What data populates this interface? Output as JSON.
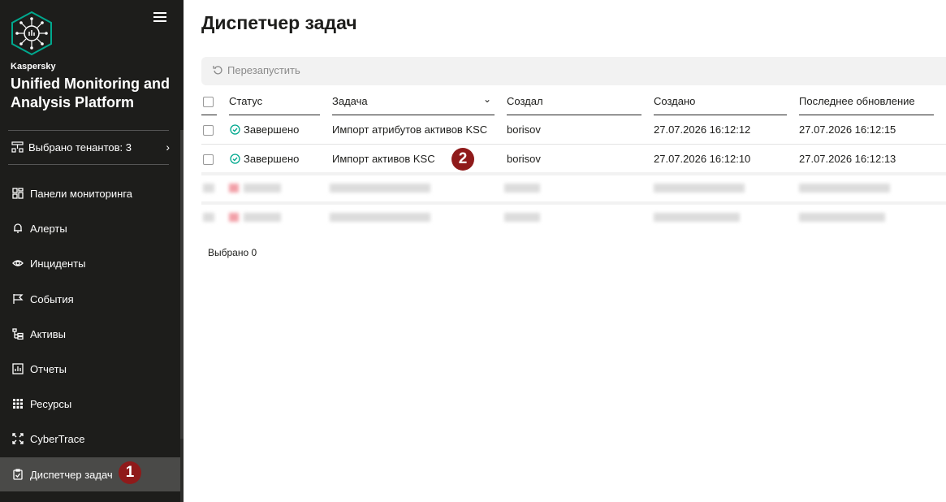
{
  "sidebar": {
    "brand_small": "Kaspersky",
    "brand_title": "Unified Monitoring and Analysis Platform",
    "tenants_label": "Выбрано тенантов: 3",
    "items": [
      {
        "label": "Панели мониторинга",
        "icon": "dashboard-icon"
      },
      {
        "label": "Алерты",
        "icon": "bell-icon"
      },
      {
        "label": "Инциденты",
        "icon": "eye-icon"
      },
      {
        "label": "События",
        "icon": "flag-icon"
      },
      {
        "label": "Активы",
        "icon": "assets-tree-icon"
      },
      {
        "label": "Отчеты",
        "icon": "report-chart-icon"
      },
      {
        "label": "Ресурсы",
        "icon": "grid-dots-icon"
      },
      {
        "label": "CyberTrace",
        "icon": "cybertrace-icon"
      },
      {
        "label": "Диспетчер задач",
        "icon": "task-clipboard-icon",
        "active": true
      }
    ]
  },
  "badges": {
    "first": "1",
    "second": "2"
  },
  "main": {
    "title": "Диспетчер задач",
    "toolbar": {
      "restart_label": "Перезапустить"
    },
    "columns": {
      "status": "Статус",
      "task": "Задача",
      "creator": "Создал",
      "created": "Создано",
      "updated": "Последнее обновление"
    },
    "rows": [
      {
        "status": "Завершено",
        "task": "Импорт атрибутов активов KSC",
        "creator": "borisov",
        "created": "27.07.2026 16:12:12",
        "updated": "27.07.2026 16:12:15"
      },
      {
        "status": "Завершено",
        "task": "Импорт активов KSC",
        "creator": "borisov",
        "created": "27.07.2026 16:12:10",
        "updated": "27.07.2026 16:12:13"
      }
    ],
    "selected_label": "Выбрано 0"
  },
  "colors": {
    "sidebar_bg": "#1d1d1b",
    "active_item": "#4a4a48",
    "accent_green": "#00a88e",
    "badge_red": "#8f1a1a"
  }
}
